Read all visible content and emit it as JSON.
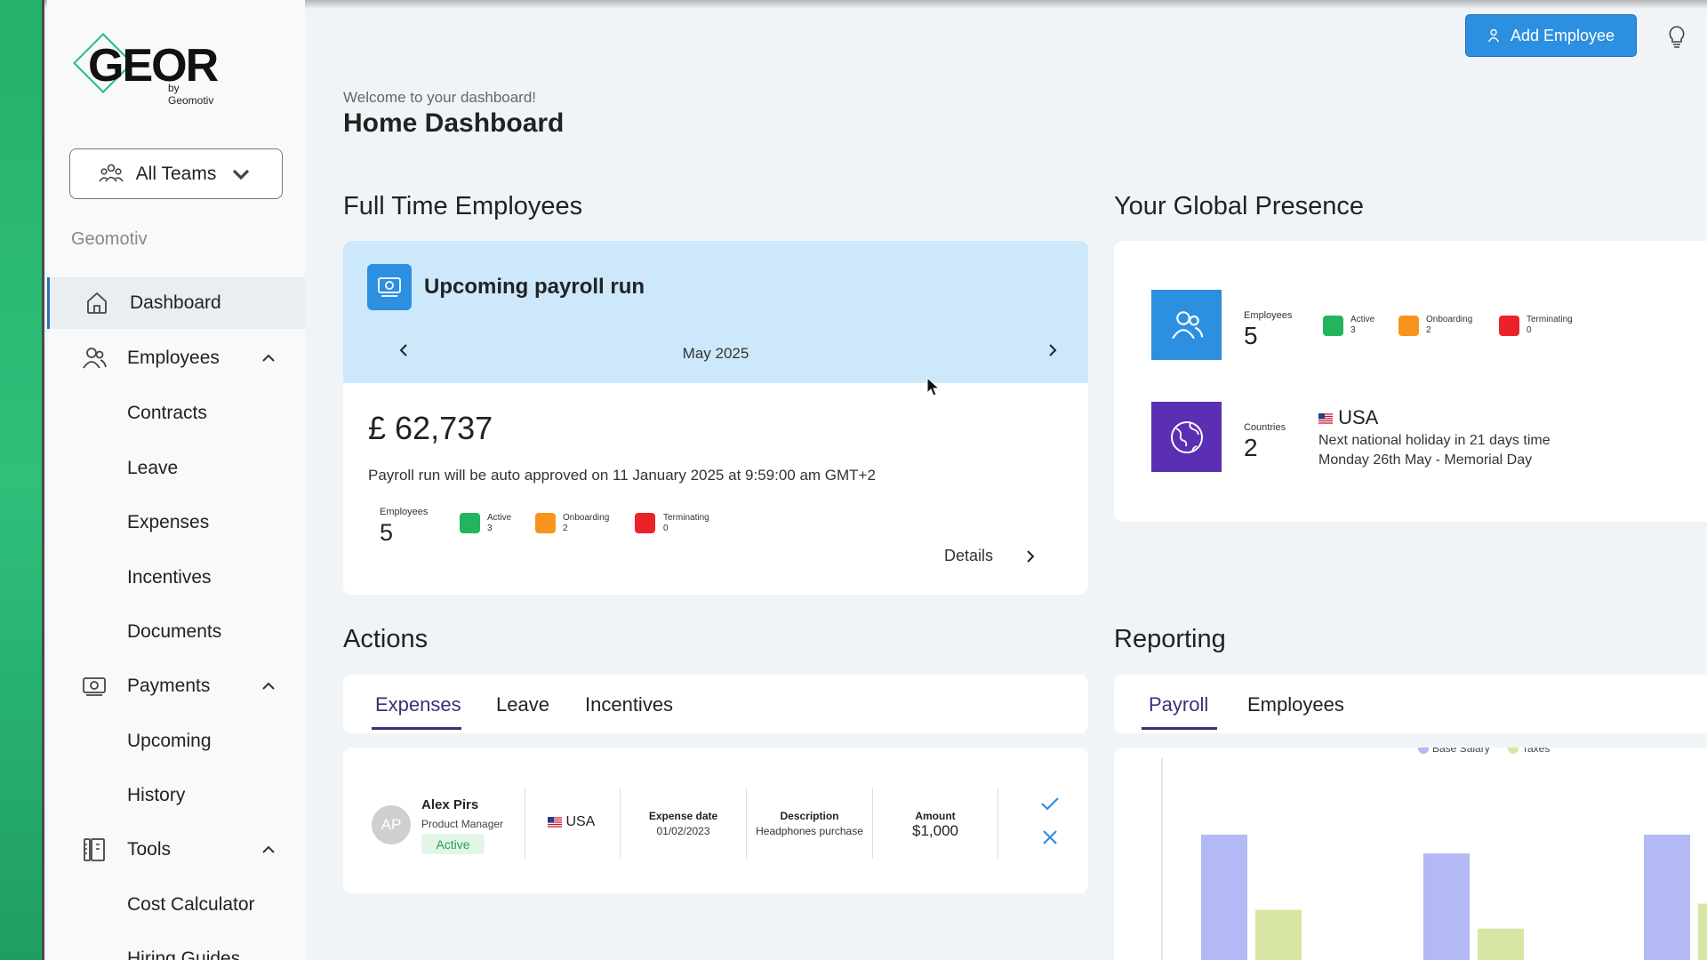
{
  "sidebar": {
    "logo_text": "GEOR",
    "logo_sub": "by Geomotiv",
    "team_select": "All Teams",
    "company": "Geomotiv",
    "nav": [
      {
        "label": "Dashboard",
        "icon": "home-icon",
        "active": true
      },
      {
        "label": "Employees",
        "icon": "users-icon",
        "expanded": true
      },
      {
        "label": "Payments",
        "icon": "money-icon",
        "expanded": true
      },
      {
        "label": "Tools",
        "icon": "tools-icon",
        "expanded": true
      }
    ],
    "employees_sub": [
      "Contracts",
      "Leave",
      "Expenses",
      "Incentives",
      "Documents"
    ],
    "payments_sub": [
      "Upcoming",
      "History"
    ],
    "tools_sub": [
      "Cost Calculator",
      "Hiring Guides"
    ]
  },
  "header": {
    "add_button": "Add Employee",
    "welcome": "Welcome to your dashboard!",
    "title": "Home Dashboard"
  },
  "full_time": {
    "section_title": "Full Time Employees",
    "card_title": "Upcoming payroll run",
    "month": "May 2025",
    "amount": "£ 62,737",
    "auto_text": "Payroll run will be auto approved on 11 January 2025 at 9:59:00 am GMT+2",
    "employees_label": "Employees",
    "employees_count": "5",
    "active_label": "Active",
    "active_count": "3",
    "onboarding_label": "Onboarding",
    "onboarding_count": "2",
    "terminating_label": "Terminating",
    "terminating_count": "0",
    "details": "Details"
  },
  "global": {
    "section_title": "Your Global Presence",
    "employees_label": "Employees",
    "employees_count": "5",
    "active_label": "Active",
    "active_count": "3",
    "onboarding_label": "Onboarding",
    "onboarding_count": "2",
    "terminating_label": "Terminating",
    "terminating_count": "0",
    "countries_label": "Countries",
    "countries_count": "2",
    "country": "USA",
    "holiday_line1": "Next national holiday in 21 days time",
    "holiday_line2": "Monday 26th May - Memorial Day"
  },
  "actions": {
    "section_title": "Actions",
    "tabs": [
      "Expenses",
      "Leave",
      "Incentives"
    ],
    "row": {
      "initials": "AP",
      "name": "Alex Pirs",
      "role": "Product Manager",
      "status": "Active",
      "country": "USA",
      "date_label": "Expense date",
      "date": "01/02/2023",
      "desc_label": "Description",
      "desc": "Headphones purchase",
      "amount_label": "Amount",
      "amount": "$1,000"
    }
  },
  "reporting": {
    "section_title": "Reporting",
    "tabs": [
      "Payroll",
      "Employees"
    ]
  },
  "chart_data": {
    "type": "bar",
    "categories": [
      "",
      "",
      ""
    ],
    "series": [
      {
        "name": "Base Salary",
        "values": [
          100,
          85,
          100
        ]
      },
      {
        "name": "Taxes",
        "values": [
          40,
          25,
          45
        ]
      }
    ],
    "colors": {
      "Base Salary": "#b3b9f5",
      "Taxes": "#d8e6a3"
    },
    "legend": "top"
  },
  "colors": {
    "accent": "#2d8fe0",
    "active": "#23b45e",
    "onboarding": "#f7941d",
    "terminating": "#ec2229",
    "tab_active": "#3d2f7a",
    "globe_bg": "#5b2fb3"
  }
}
